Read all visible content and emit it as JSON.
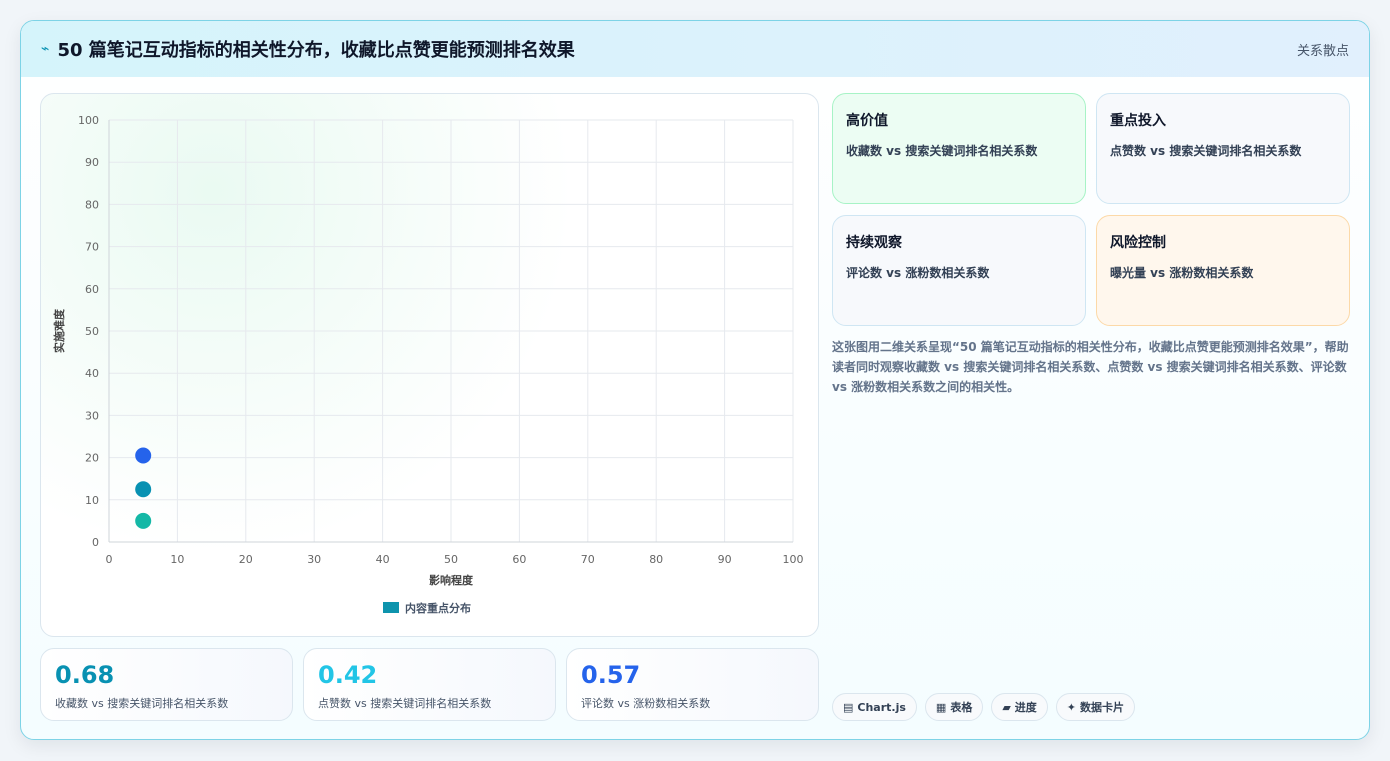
{
  "header": {
    "icon": "bolt-icon",
    "title": "50 篇笔记互动指标的相关性分布，收藏比点赞更能预测排名效果",
    "badge": "关系散点"
  },
  "chart_data": {
    "type": "scatter",
    "xlabel": "影响程度",
    "ylabel": "实施难度",
    "xlim": [
      0,
      100
    ],
    "ylim": [
      0,
      100
    ],
    "x_ticks": [
      "0",
      "10",
      "20",
      "30",
      "40",
      "50",
      "60",
      "70",
      "80",
      "90",
      "100"
    ],
    "y_ticks": [
      "0",
      "10",
      "20",
      "30",
      "40",
      "50",
      "60",
      "70",
      "80",
      "90",
      "100"
    ],
    "grid": true,
    "legend_position": "bottom",
    "series": [
      {
        "name": "内容重点分布",
        "color": "#0e94ad",
        "points": [
          {
            "x": 5,
            "y": 20.5,
            "color": "#2563eb"
          },
          {
            "x": 5,
            "y": 12.5,
            "color": "#0891b2"
          },
          {
            "x": 5,
            "y": 5,
            "color": "#14b8a6"
          }
        ]
      }
    ]
  },
  "kpis": [
    {
      "value": "0.68",
      "label": "收藏数 vs 搜索关键词排名相关系数",
      "color": "#0891b2"
    },
    {
      "value": "0.42",
      "label": "点赞数 vs 搜索关键词排名相关系数",
      "color": "#22c5e6"
    },
    {
      "value": "0.57",
      "label": "评论数 vs 涨粉数相关系数",
      "color": "#2563eb"
    }
  ],
  "quadrants": [
    {
      "title": "高价值",
      "desc": "收藏数 vs 搜索关键词排名相关系数",
      "bg": "#ecfdf3",
      "border": "#a7f3c6"
    },
    {
      "title": "重点投入",
      "desc": "点赞数 vs 搜索关键词排名相关系数",
      "bg": "#f7f9fc",
      "border": "#cfe6f3"
    },
    {
      "title": "持续观察",
      "desc": "评论数 vs 涨粉数相关系数",
      "bg": "#f7f9fc",
      "border": "#cfe6f3"
    },
    {
      "title": "风险控制",
      "desc": "曝光量 vs 涨粉数相关系数",
      "bg": "#fff7ed",
      "border": "#fcd9a8"
    }
  ],
  "description": "这张图用二维关系呈现“50 篇笔记互动指标的相关性分布，收藏比点赞更能预测排名效果”，帮助读者同时观察收藏数 vs 搜索关键词排名相关系数、点赞数 vs 搜索关键词排名相关系数、评论数 vs 涨粉数相关系数之间的相关性。",
  "chips": [
    {
      "icon": "▤",
      "label": "Chart.js"
    },
    {
      "icon": "▦",
      "label": "表格"
    },
    {
      "icon": "▰",
      "label": "进度"
    },
    {
      "icon": "✦",
      "label": "数据卡片"
    }
  ]
}
